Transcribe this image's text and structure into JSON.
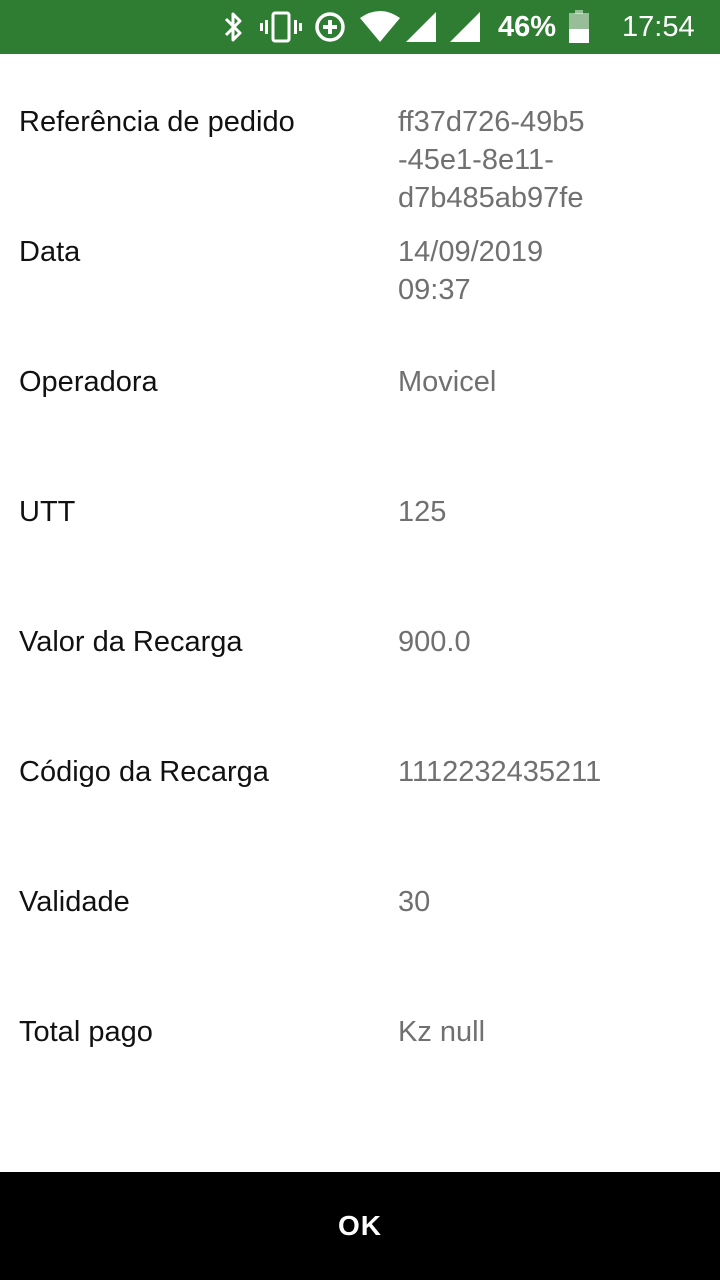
{
  "status_bar": {
    "battery_percent": "46%",
    "time": "17:54",
    "icons": [
      "bluetooth-icon",
      "vibrate-icon",
      "data-saver-icon",
      "wifi-icon",
      "signal-icon",
      "signal-icon",
      "battery-icon"
    ],
    "background_color": "#2e7d32"
  },
  "details": [
    {
      "label": "Referência de pedido",
      "value": "ff37d726-49b5\n-45e1-8e11-\nd7b485ab97fe"
    },
    {
      "label": "Data",
      "value": "14/09/2019\n09:37"
    },
    {
      "label": "Operadora",
      "value": "Movicel"
    },
    {
      "label": "UTT",
      "value": "125"
    },
    {
      "label": "Valor da Recarga",
      "value": "900.0"
    },
    {
      "label": "Código da Recarga",
      "value": "1112232435211"
    },
    {
      "label": "Validade",
      "value": "30"
    },
    {
      "label": "Total pago",
      "value": "Kz null"
    }
  ],
  "footer": {
    "ok_label": "OK"
  }
}
